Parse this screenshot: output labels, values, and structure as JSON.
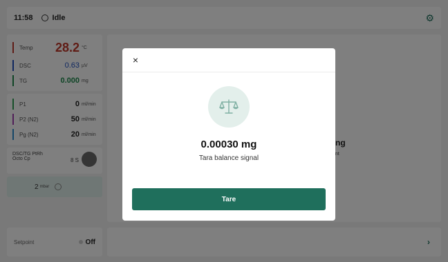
{
  "topbar": {
    "time": "11:58",
    "status": "Idle"
  },
  "sidebar": {
    "sensors": [
      {
        "label": "Temp",
        "value": "28.2",
        "unit": "°C",
        "color": "#c0392b"
      },
      {
        "label": "DSC",
        "value": "0.63",
        "unit": "µV",
        "color": "#1f4fbf"
      },
      {
        "label": "TG",
        "value": "0.000",
        "unit": "mg",
        "color": "#1f8a4c"
      }
    ],
    "gases": [
      {
        "label": "P1",
        "value": "0",
        "unit": "ml/min",
        "color": "#2e9e55"
      },
      {
        "label": "P2 (N2)",
        "value": "50",
        "unit": "ml/min",
        "color": "#a23cb0"
      },
      {
        "label": "Pg (N2)",
        "value": "20",
        "unit": "ml/min",
        "color": "#2a8fd0"
      }
    ],
    "sample": {
      "line1": "DSC/TG PtRh",
      "line2": "Octo Cp",
      "value": "8 S"
    },
    "pressure": {
      "value": "2",
      "unit": "mbar"
    }
  },
  "main": {
    "bg_text": "ng",
    "bg_sub": "nt"
  },
  "bottom": {
    "setpoint_label": "Setpoint",
    "setpoint_value": "Off",
    "next": "›"
  },
  "modal": {
    "close": "×",
    "value": "0.00030 mg",
    "caption": "Tara balance signal",
    "button_label": "Tare",
    "accent": "#1f6f5c"
  }
}
